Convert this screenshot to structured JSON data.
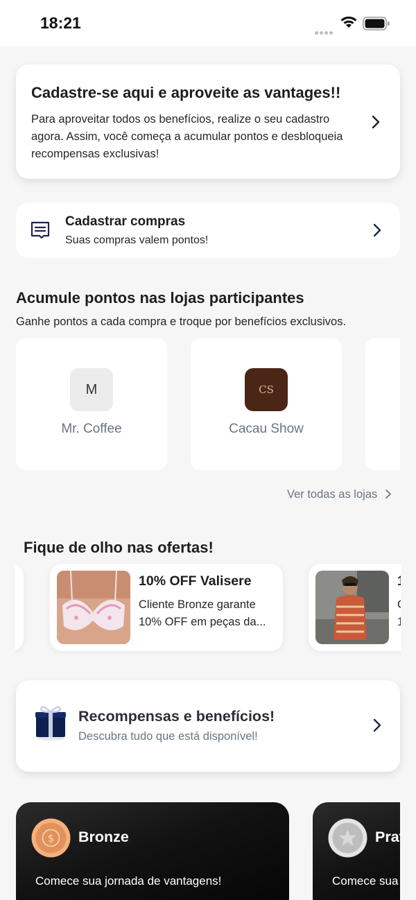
{
  "status_bar": {
    "time": "18:21"
  },
  "signup_card": {
    "title": "Cadastre-se aqui e aproveite as vantages!!",
    "text": "Para aproveitar todos os benefícios, realize o seu cadastro agora. Assim, você começa a acumular pontos e desbloqueia recompensas exclusivas!"
  },
  "purchases_card": {
    "title": "Cadastrar compras",
    "subtitle": "Suas compras valem pontos!"
  },
  "stores_section": {
    "title": "Acumule pontos nas lojas participantes",
    "subtitle": "Ganhe pontos a cada compra e troque por benefícios exclusivos.",
    "stores": [
      {
        "name": "Mr. Coffee",
        "logo_letter": "M"
      },
      {
        "name": "Cacau Show",
        "logo_letter": "CS"
      }
    ],
    "see_all": "Ver todas as lojas"
  },
  "offers_section": {
    "title": "Fique de olho nas ofertas!",
    "offers": [
      {
        "title": "10% OFF Valisere",
        "description": "Cliente Bronze garante 10% OFF em peças da..."
      },
      {
        "title": "1",
        "description": "C\n1"
      }
    ]
  },
  "rewards_card": {
    "title": "Recompensas e benefícios!",
    "subtitle": "Descubra tudo que está disponível!"
  },
  "tiers": [
    {
      "name": "Bronze",
      "subtitle": "Comece sua jornada de vantagens!",
      "color": "#e0925a"
    },
    {
      "name": "Prata",
      "subtitle": "Comece sua",
      "color": "#c8c8c8"
    }
  ]
}
